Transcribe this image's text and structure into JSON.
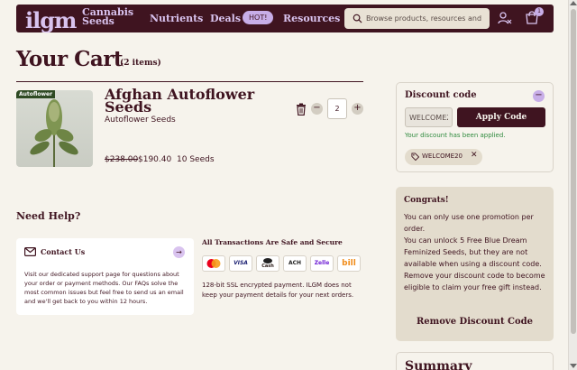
{
  "nav": {
    "logo": "ilgm",
    "cannabis_seeds": "Cannabis Seeds",
    "nutrients": "Nutrients",
    "deals": "Deals",
    "hot_badge": "HOT!",
    "resources": "Resources",
    "search_placeholder": "Browse products, resources and ...",
    "cart_count": "1"
  },
  "cart": {
    "title": "Your Cart",
    "item_count": "(2 items)",
    "product": {
      "badge": "Autoflower",
      "name": "Afghan Autoflower Seeds",
      "category": "Autoflower Seeds",
      "quantity": "2",
      "old_price": "$238.00",
      "new_price": "$190.40",
      "seeds": "10 Seeds"
    }
  },
  "help": {
    "title": "Need Help?",
    "contact_title": "Contact Us",
    "contact_text": "Visit our dedicated support page for questions about your order or payment methods. Our FAQs solve the most common issues but feel free to send us an email and we'll get back to you within 12 hours.",
    "secure_title": "All Transactions Are Safe and Secure",
    "payment_methods": [
      "mastercard",
      "VISA",
      "Cash",
      "ACH",
      "Zelle",
      "bill"
    ],
    "secure_text": "128-bit SSL encrypted payment. ILGM does not keep your payment details for your next orders."
  },
  "discount": {
    "title": "Discount code",
    "input_value": "WELCOME20",
    "apply_label": "Apply Code",
    "applied_msg": "Your discount has been applied.",
    "chip_code": "WELCOME20"
  },
  "congrats": {
    "title": "Congrats!",
    "line1": "You can only use one promotion per order.",
    "line2": "You can unlock 5 Free Blue Dream Feminized Seeds, but they are not available when using a discount code. Remove your discount code to become eligible to claim your free gift instead.",
    "remove_label": "Remove Discount Code"
  },
  "summary": {
    "title": "Summary"
  },
  "colors": {
    "brand": "#3f1420",
    "accent": "#c8aee8",
    "success": "#2f8a3e",
    "background": "#f6f3ec"
  }
}
